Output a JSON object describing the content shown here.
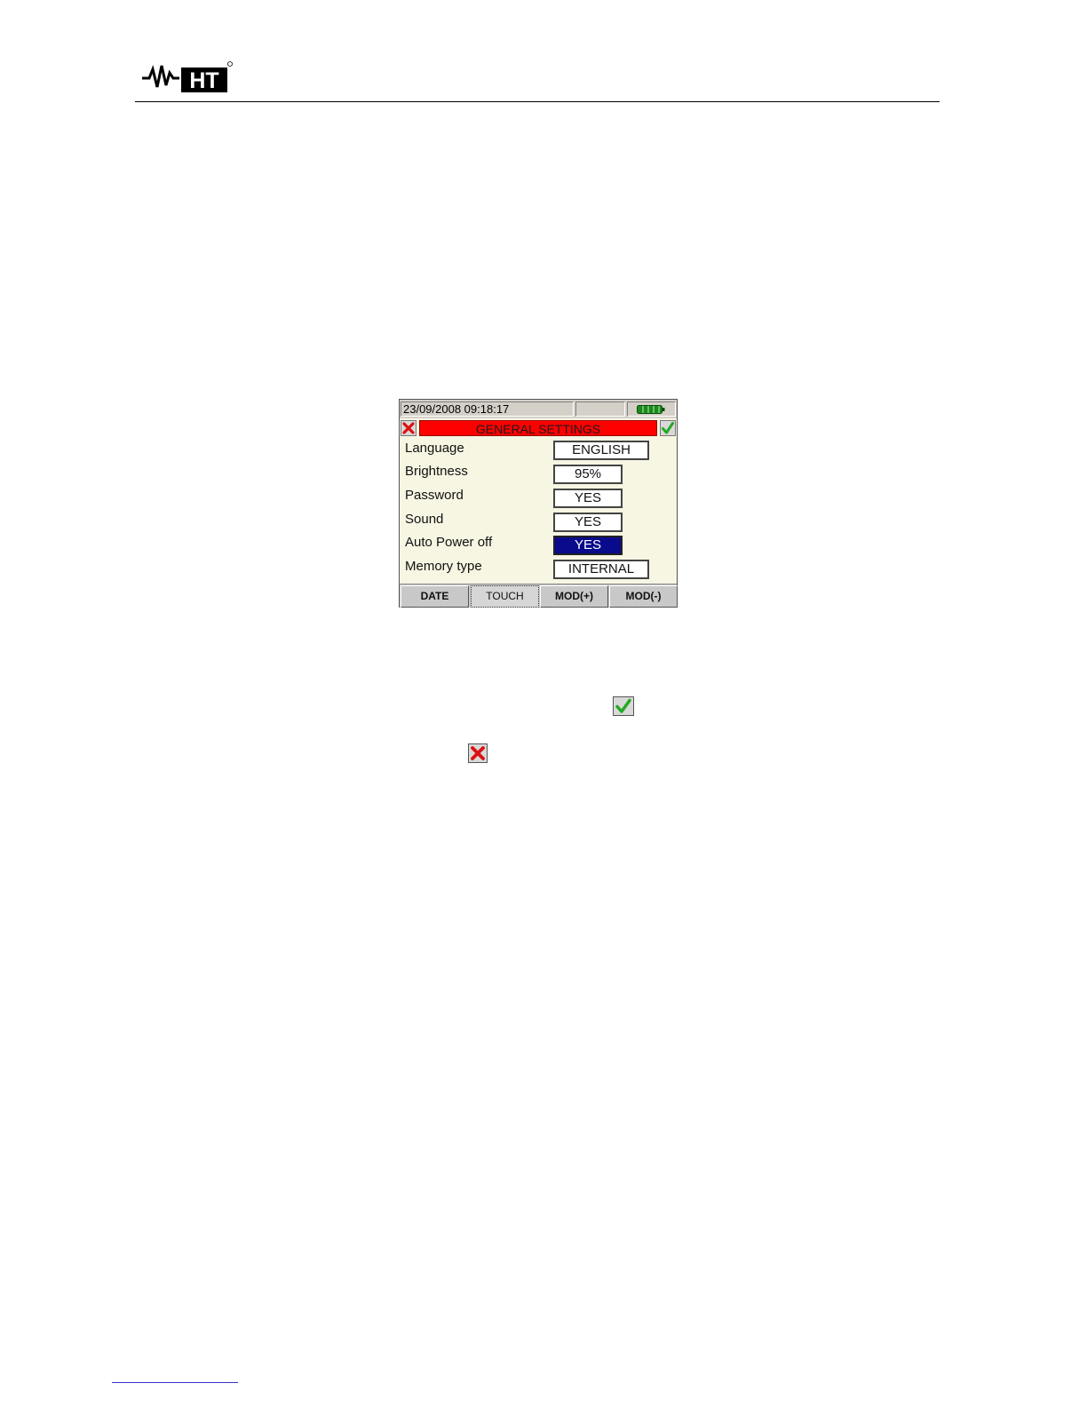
{
  "brand": {
    "logo_text": "HT"
  },
  "status_bar": {
    "datetime": "23/09/2008 09:18:17"
  },
  "title_bar": {
    "title": "GENERAL SETTINGS"
  },
  "settings": [
    {
      "label": "Language",
      "value": "ENGLISH",
      "selected": false
    },
    {
      "label": "Brightness",
      "value": "95%",
      "selected": false
    },
    {
      "label": "Password",
      "value": "YES",
      "selected": false
    },
    {
      "label": "Sound",
      "value": "YES",
      "selected": false
    },
    {
      "label": "Auto Power off",
      "value": "YES",
      "selected": true
    },
    {
      "label": "Memory type",
      "value": "INTERNAL",
      "selected": false
    }
  ],
  "softkeys": [
    {
      "label": "DATE"
    },
    {
      "label": "TOUCH"
    },
    {
      "label": "MOD(+)"
    },
    {
      "label": "MOD(-)"
    }
  ],
  "colors": {
    "title_bg": "#ff0000",
    "selected_bg": "#0a0a8c",
    "screen_bg": "#f7f6e3",
    "confirm_green": "#22aa22",
    "cancel_red": "#dd1111"
  },
  "icons": [
    "ht-logo",
    "battery-icon",
    "cancel-x-icon",
    "confirm-check-icon"
  ]
}
